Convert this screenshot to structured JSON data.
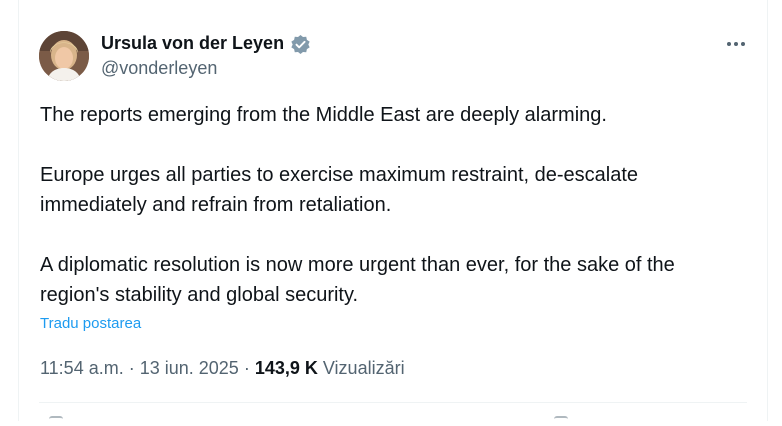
{
  "author": {
    "name": "Ursula von der Leyen",
    "handle": "@vonderleyen"
  },
  "tweet": {
    "paragraphs": [
      "The reports emerging from the Middle East are deeply alarming.",
      "Europe urges all parties to exercise maximum restraint,  de-escalate immediately and refrain from retaliation.",
      "A diplomatic resolution is now more urgent than ever, for the sake of the region's stability and global security."
    ],
    "translate_label": "Tradu postarea"
  },
  "meta": {
    "time": "11:54 a.m.",
    "separator": " · ",
    "date": "13 iun. 2025",
    "views_count": "143,9 K",
    "views_label": "Vizualizări"
  },
  "icons": {
    "verified": "verified-badge-icon",
    "more": "more-horizontal-icon"
  },
  "colors": {
    "text": "#0f1419",
    "secondary": "#536471",
    "link": "#1d9bf0",
    "border": "#eff3f4"
  }
}
